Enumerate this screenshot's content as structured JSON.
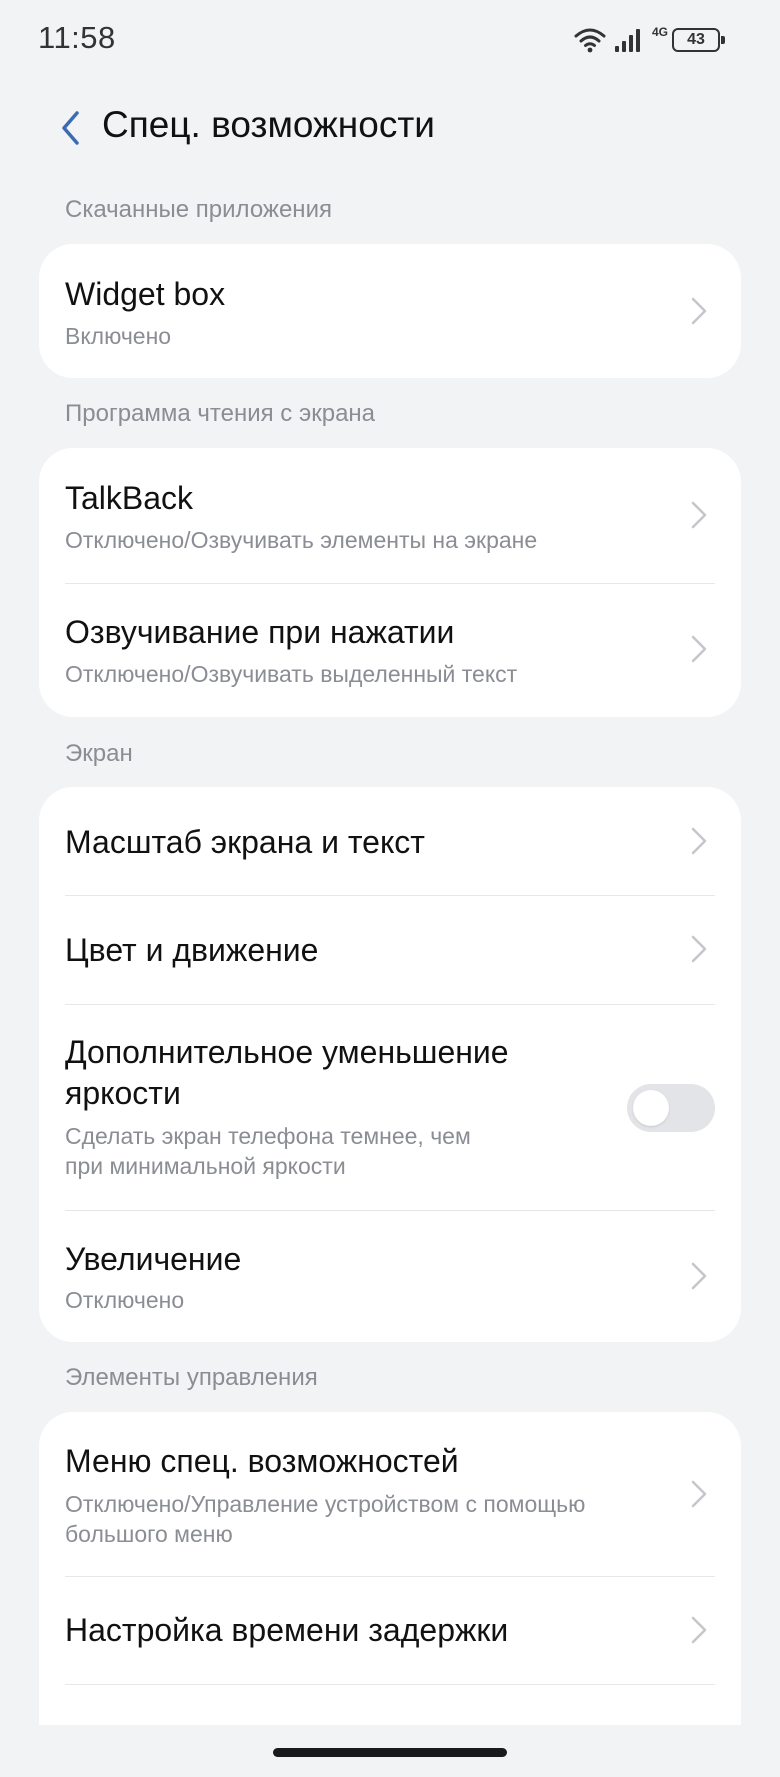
{
  "status_bar": {
    "time": "11:58",
    "network": "4G",
    "battery": "43"
  },
  "header": {
    "title": "Спец. возможности"
  },
  "sections": {
    "downloaded": {
      "label": "Скачанные приложения",
      "widget_box": {
        "title": "Widget box",
        "subtitle": "Включено"
      }
    },
    "screen_reader": {
      "label": "Программа чтения с экрана",
      "talkback": {
        "title": "TalkBack",
        "subtitle": "Отключено/Озвучивать элементы на экране"
      },
      "select_to_speak": {
        "title": "Озвучивание при нажатии",
        "subtitle": "Отключено/Озвучивать выделенный текст"
      }
    },
    "display": {
      "label": "Экран",
      "display_size": {
        "title": "Масштаб экрана и текст"
      },
      "color_motion": {
        "title": "Цвет и движение"
      },
      "extra_dim": {
        "title_line1": "Дополнительное уменьшение",
        "title_line2": "яркости",
        "subtitle_line1": "Сделать экран телефона темнее, чем",
        "subtitle_line2": "при минимальной яркости",
        "enabled": false
      },
      "magnification": {
        "title": "Увеличение",
        "subtitle": "Отключено"
      }
    },
    "controls": {
      "label": "Элементы управления",
      "a11y_menu": {
        "title": "Меню спец. возможностей",
        "subtitle_line1": "Отключено/Управление устройством с помощью",
        "subtitle_line2": "большого меню"
      },
      "timing": {
        "title": "Настройка времени задержки"
      }
    }
  },
  "colors": {
    "background": "#f2f3f5",
    "card": "#ffffff",
    "secondary_text": "#8a8d93",
    "back_arrow": "#3d6bb3"
  }
}
